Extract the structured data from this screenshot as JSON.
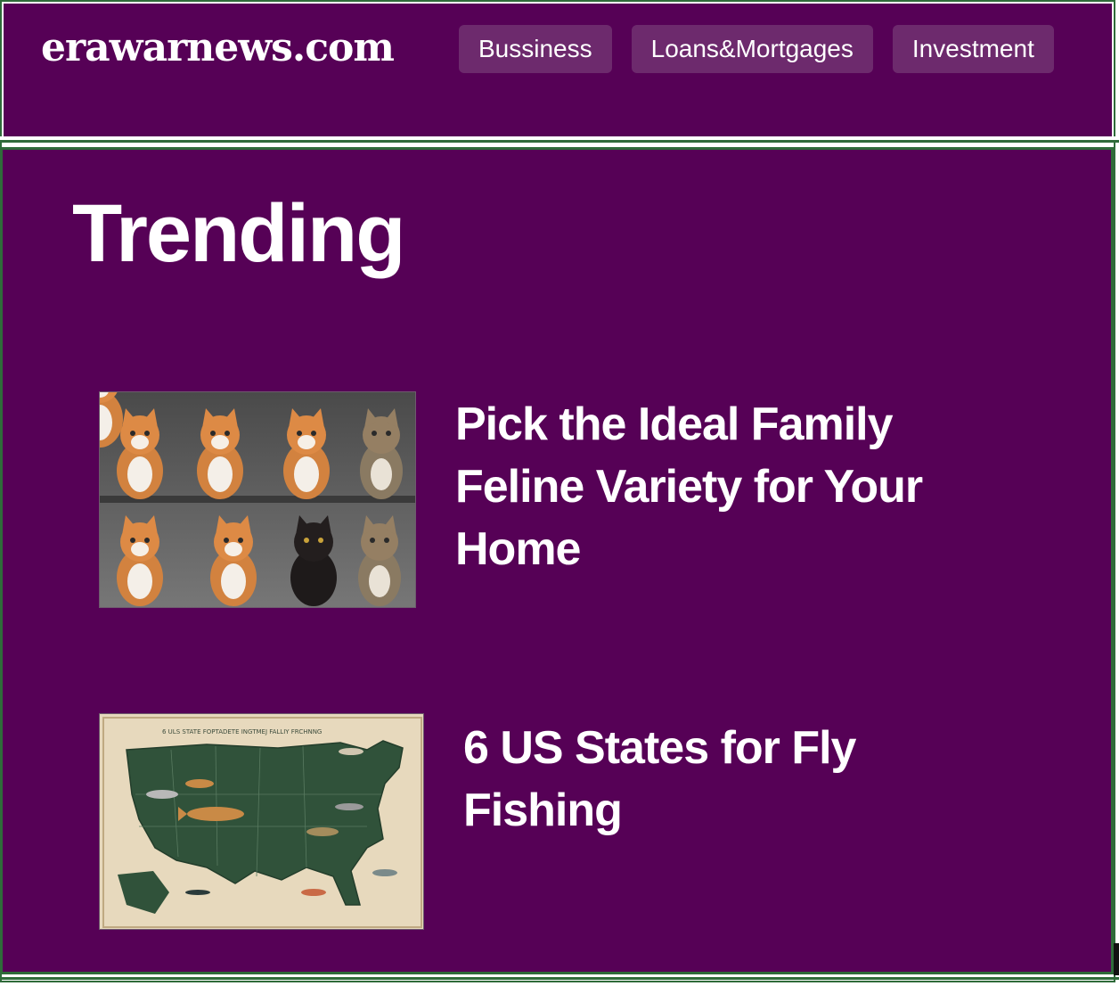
{
  "site": {
    "logo": "erawarnews.com"
  },
  "nav": {
    "items": [
      {
        "label": "Bussiness"
      },
      {
        "label": "Loans&Mortgages"
      },
      {
        "label": "Investment"
      }
    ]
  },
  "section": {
    "heading": "Trending"
  },
  "articles": [
    {
      "title": "Pick the Ideal Family Feline Variety for Your Home"
    },
    {
      "title": "6 US States for Fly Fishing",
      "image_caption": "6 ULS STATE FOPTADETE INGTMEJ FALLIY FRCHNNG"
    }
  ],
  "colors": {
    "background": "#560156",
    "nav_button": "#6d2a6d",
    "frame": "#2f6b3a",
    "text": "#ffffff"
  }
}
